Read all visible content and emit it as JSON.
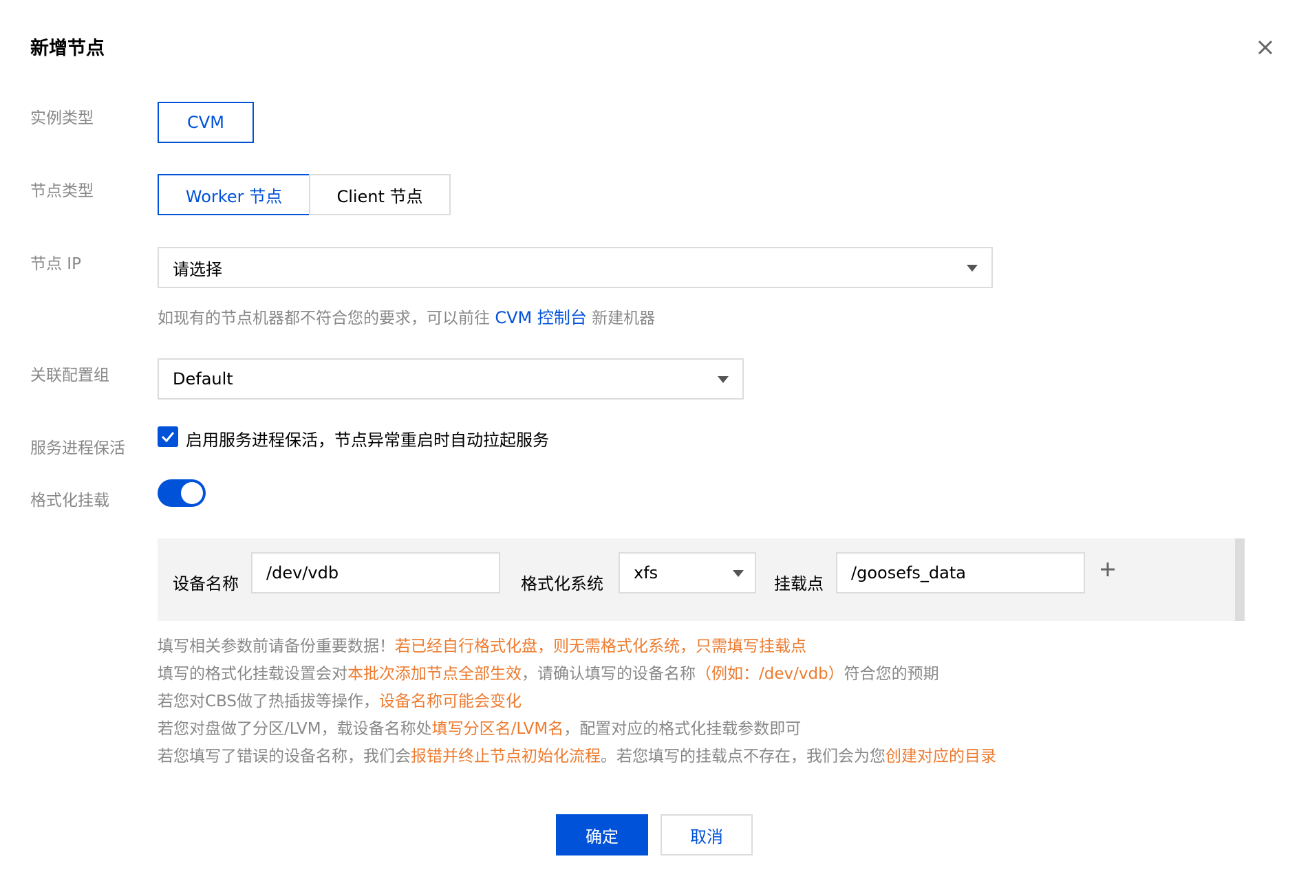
{
  "dialog": {
    "title": "新增节点"
  },
  "icons": {
    "close": "close-icon",
    "caret": "caret-down-icon",
    "check": "check-icon",
    "plus": "plus-icon"
  },
  "colors": {
    "primary": "#0052d9",
    "warning": "#ed7b2f",
    "label": "#888888",
    "panel_bg": "#f3f3f3"
  },
  "form": {
    "instance_type": {
      "label": "实例类型",
      "options": [
        "CVM"
      ],
      "selected": "CVM"
    },
    "node_type": {
      "label": "节点类型",
      "options": [
        "Worker 节点",
        "Client 节点"
      ],
      "selected": "Worker 节点"
    },
    "node_ip": {
      "label": "节点 IP",
      "value": "请选择",
      "hint_prefix": "如现有的节点机器都不符合您的要求，可以前往",
      "hint_link": "CVM 控制台",
      "hint_suffix": "新建机器"
    },
    "config_group": {
      "label": "关联配置组",
      "value": "Default"
    },
    "keepalive": {
      "label": "服务进程保活",
      "checked": true,
      "text": "启用服务进程保活，节点异常重启时自动拉起服务"
    },
    "format_mount": {
      "label": "格式化挂载",
      "enabled": true
    }
  },
  "mount": {
    "device_label": "设备名称",
    "device_value": "/dev/vdb",
    "fs_label": "格式化系统",
    "fs_value": "xfs",
    "mountpoint_label": "挂载点",
    "mountpoint_value": "/goosefs_data"
  },
  "notes": {
    "line1": [
      "填写相关参数前请备份重要数据！",
      "若已经自行格式化盘，则无需格式化系统，只需填写挂载点"
    ],
    "line2": [
      "填写的格式化挂载设置会对",
      "本批次添加节点全部生效",
      "，请确认填写的设备名称",
      "（例如：/dev/vdb）",
      "符合您的预期"
    ],
    "line3": [
      "若您对CBS做了热插拔等操作，",
      "设备名称可能会变化"
    ],
    "line4": [
      "若您对盘做了分区/LVM，载设备名称处",
      "填写分区名/LVM名",
      "，配置对应的格式化挂载参数即可"
    ],
    "line5": [
      "若您填写了错误的设备名称，我们会",
      "报错并终止节点初始化流程",
      "。若您填写的挂载点不存在，我们会为您",
      "创建对应的目录"
    ]
  },
  "footer": {
    "confirm": "确定",
    "cancel": "取消"
  }
}
